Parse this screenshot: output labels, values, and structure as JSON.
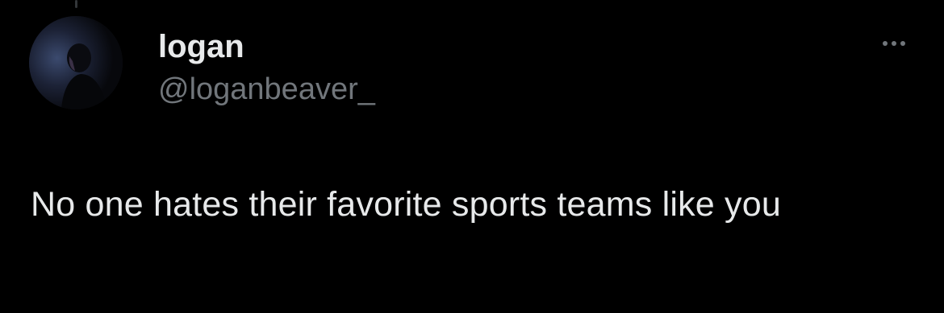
{
  "tweet": {
    "author": {
      "name": "logan",
      "handle": "@loganbeaver_"
    },
    "text": "No one hates their favorite sports teams like you",
    "more_icon": "more-horizontal-icon"
  },
  "colors": {
    "background": "#000000",
    "primary_text": "#e7e9ea",
    "secondary_text": "#71767b"
  }
}
